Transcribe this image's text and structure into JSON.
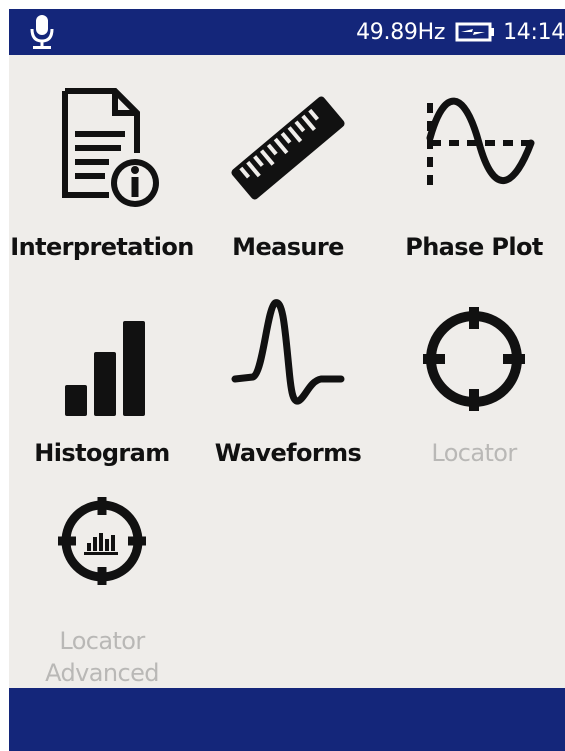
{
  "status": {
    "frequency": "49.89Hz",
    "time": "14:14"
  },
  "apps": [
    {
      "label": "Interpretation",
      "icon": "interpretation-icon",
      "enabled": true
    },
    {
      "label": "Measure",
      "icon": "ruler-icon",
      "enabled": true
    },
    {
      "label": "Phase Plot",
      "icon": "phase-plot-icon",
      "enabled": true
    },
    {
      "label": "Histogram",
      "icon": "histogram-icon",
      "enabled": true
    },
    {
      "label": "Waveforms",
      "icon": "waveform-icon",
      "enabled": true
    },
    {
      "label": "Locator",
      "icon": "crosshair-icon",
      "enabled": false
    },
    {
      "label_line1": "Locator",
      "label_line2": "Advanced",
      "icon": "crosshair-histogram-icon",
      "enabled": false
    }
  ],
  "colors": {
    "bar": "#14267a",
    "background": "#efedea",
    "icon": "#111111",
    "disabled_text": "#b9b8b6"
  }
}
